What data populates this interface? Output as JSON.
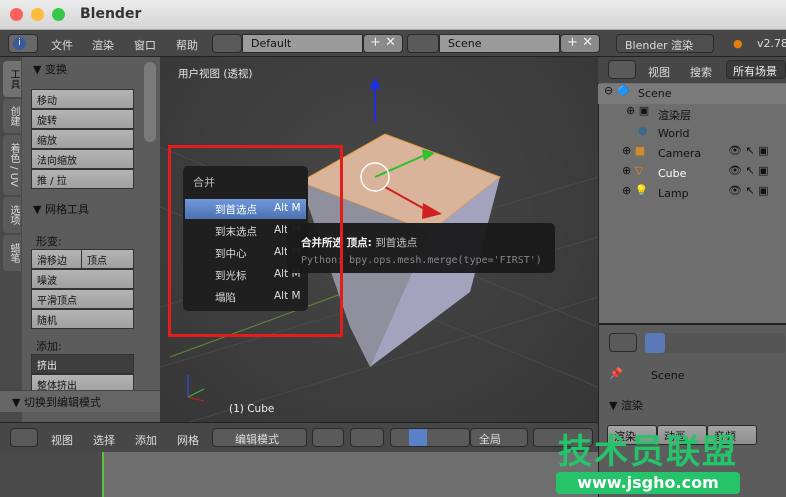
{
  "window": {
    "title": "Blender"
  },
  "topbar": {
    "menus": [
      "文件",
      "渲染",
      "窗口",
      "帮助"
    ],
    "layout": "Default",
    "scene": "Scene",
    "engine": "Blender 渲染",
    "version": "v2.78"
  },
  "shelf": {
    "tabs": [
      "工具",
      "创建",
      "着色 / UV",
      "选项",
      "蜡笔"
    ],
    "transform": {
      "title": "变换",
      "buttons": [
        "移动",
        "旋转",
        "缩放",
        "法向缩放",
        "推 / 拉"
      ]
    },
    "mesh_tools": {
      "title": "网格工具",
      "deform_label": "形变:",
      "slide_edge": "滑移边",
      "vertex": "顶点",
      "buttons": [
        "噪波",
        "平滑顶点",
        "随机"
      ],
      "add_label": "添加:",
      "extrude": "挤出",
      "extrude_all": "整体挤出"
    },
    "toggle_edit": "切换到编辑模式"
  },
  "viewport": {
    "label": "用户视图 (透视)",
    "object": "(1) Cube"
  },
  "merge_menu": {
    "title": "合并",
    "items": [
      {
        "label": "到首选点",
        "key": "Alt M"
      },
      {
        "label": "到末选点",
        "key": "Alt M"
      },
      {
        "label": "到中心",
        "key": "Alt M"
      },
      {
        "label": "到光标",
        "key": "Alt M"
      },
      {
        "label": "塌陷",
        "key": "Alt M"
      }
    ]
  },
  "tooltip": {
    "title": "合并所选 顶点:",
    "value": "到首选点",
    "python": "Python: bpy.ops.mesh.merge(type='FIRST')"
  },
  "outliner": {
    "menus": [
      "视图",
      "搜索"
    ],
    "filter": "所有场景",
    "rows": [
      "Scene",
      "渲染层",
      "World",
      "Camera",
      "Cube",
      "Lamp"
    ]
  },
  "properties": {
    "scene": "Scene",
    "panel": "渲染",
    "buttons": [
      "渲染",
      "动画",
      "音频"
    ]
  },
  "view3d_header": {
    "menus": [
      "视图",
      "选择",
      "添加",
      "网格"
    ],
    "mode": "编辑模式",
    "orientation": "全局"
  },
  "watermark": {
    "name": "技术员联盟",
    "url": "www.jsgho.com"
  }
}
